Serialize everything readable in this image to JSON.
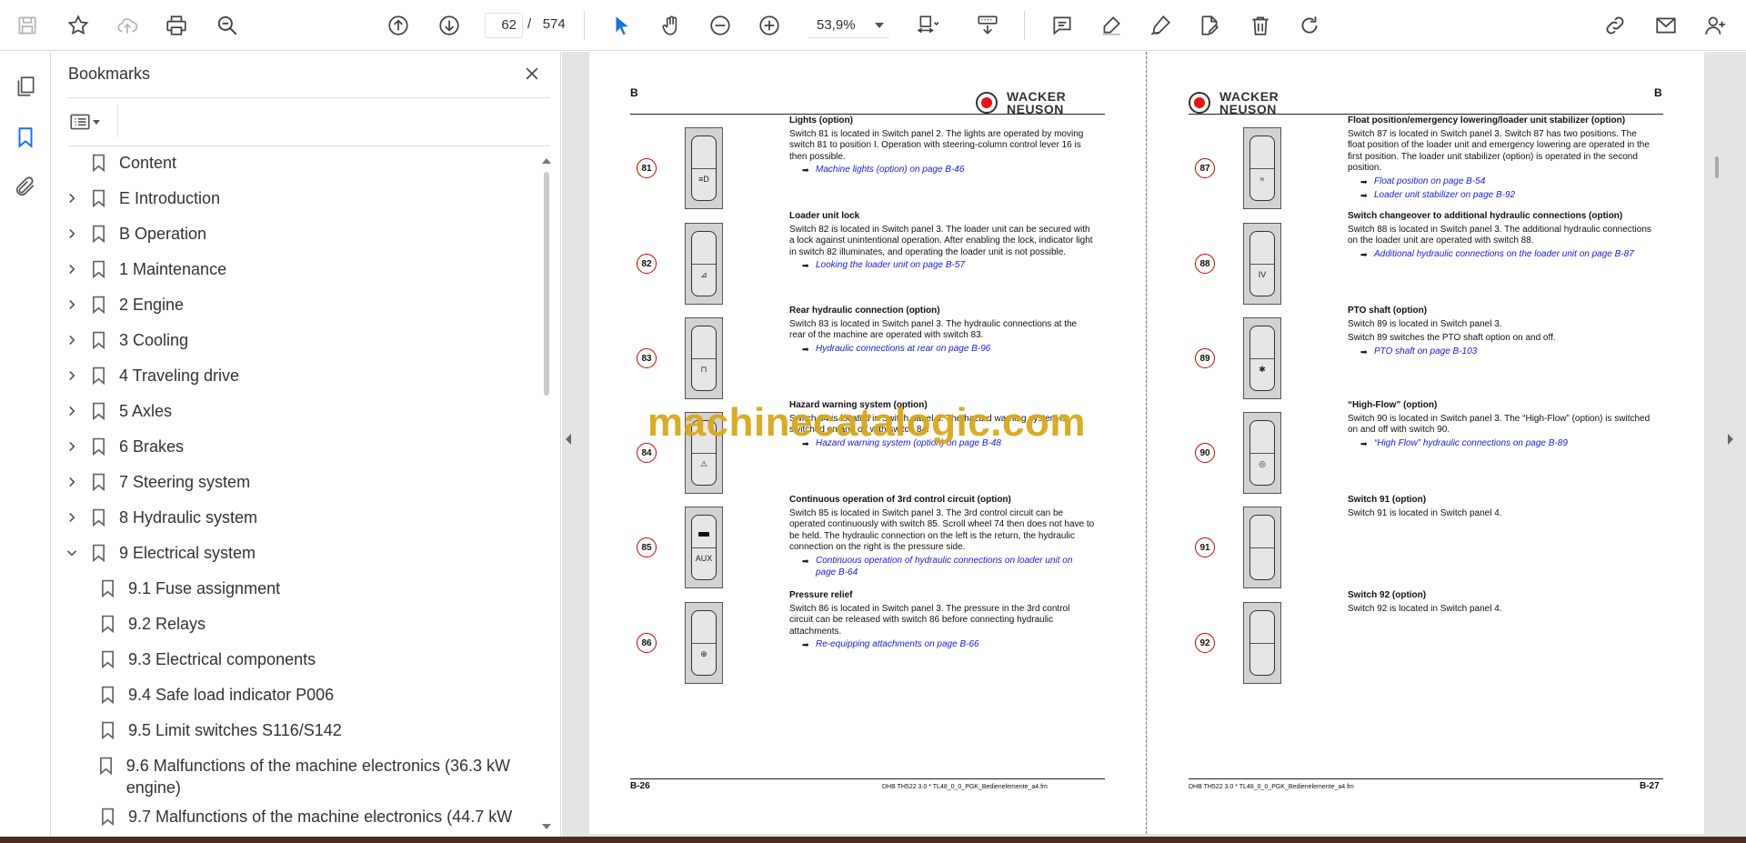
{
  "toolbar": {
    "page_current": "62",
    "page_total": "574",
    "page_sep": "/",
    "zoom": "53,9%"
  },
  "bookmarks_panel": {
    "title": "Bookmarks",
    "items": [
      {
        "label": "Content",
        "chevron": "none",
        "level": 0
      },
      {
        "label": "E Introduction",
        "chevron": "right",
        "level": 0
      },
      {
        "label": "B Operation",
        "chevron": "right",
        "level": 0
      },
      {
        "label": "1 Maintenance",
        "chevron": "right",
        "level": 0
      },
      {
        "label": "2 Engine",
        "chevron": "right",
        "level": 0
      },
      {
        "label": "3 Cooling",
        "chevron": "right",
        "level": 0
      },
      {
        "label": "4 Traveling drive",
        "chevron": "right",
        "level": 0
      },
      {
        "label": "5 Axles",
        "chevron": "right",
        "level": 0
      },
      {
        "label": "6 Brakes",
        "chevron": "right",
        "level": 0
      },
      {
        "label": "7 Steering system",
        "chevron": "right",
        "level": 0
      },
      {
        "label": "8 Hydraulic system",
        "chevron": "right",
        "level": 0
      },
      {
        "label": "9 Electrical system",
        "chevron": "down",
        "level": 0
      },
      {
        "label": "9.1 Fuse assignment",
        "chevron": "none",
        "level": 1
      },
      {
        "label": "9.2 Relays",
        "chevron": "none",
        "level": 1
      },
      {
        "label": "9.3 Electrical components",
        "chevron": "none",
        "level": 1
      },
      {
        "label": "9.4 Safe load indicator P006",
        "chevron": "none",
        "level": 1
      },
      {
        "label": "9.5 Limit switches S116/S142",
        "chevron": "none",
        "level": 1
      },
      {
        "label": "9.6 Malfunctions of the machine electronics (36.3 kW engine)",
        "chevron": "none",
        "level": 1
      },
      {
        "label": "9.7 Malfunctions of the machine electronics (44.7 kW",
        "chevron": "none",
        "level": 1
      }
    ]
  },
  "left_page": {
    "section_letter": "B",
    "logo_line1": "WACKER",
    "logo_line2": "NEUSON",
    "page_number": "B-26",
    "footer_file": "DHB TH522 3.0 * TL48_0_0_PGK_Bedienelemente_a4.fm",
    "entries": [
      {
        "num": "81",
        "symbol": "≡D",
        "title": "Lights (option)",
        "body": "Switch 81 is located in Switch panel 2. The lights are operated by moving switch 81 to position I. Operation with steering-column control lever 16 is then possible.",
        "refs": [
          "Machine lights (option) on page B-46"
        ]
      },
      {
        "num": "82",
        "symbol": "⊿",
        "title": "Loader unit lock",
        "body": "Switch 82 is located in Switch panel 3. The loader unit can be secured with a lock against unintentional operation. After enabling the lock, indicator light in switch 82 illuminates, and operating the loader unit is not possible.",
        "refs": [
          "Looking the loader unit on page B-57"
        ]
      },
      {
        "num": "83",
        "symbol": "⊓",
        "title": "Rear hydraulic connection (option)",
        "body": "Switch 83 is located in Switch panel 3. The hydraulic connections at the rear of the machine are operated with switch 83.",
        "refs": [
          "Hydraulic connections at rear on page B-96"
        ]
      },
      {
        "num": "84",
        "symbol": "⚠",
        "title": "Hazard warning system (option)",
        "body": "Switch 84 is located in Switch panel 3. The hazard warning system is switched on and off with switch 84.",
        "refs": [
          "Hazard warning system (option) on page B-48"
        ]
      },
      {
        "num": "85",
        "symbol": "AUX",
        "title": "Continuous operation of 3rd control circuit (option)",
        "body": "Switch 85 is located in Switch panel 3. The 3rd control circuit can be operated continuously with switch 85. Scroll wheel 74 then does not have to be held. The hydraulic connection on the left is the return, the hydraulic connection on the right is the pressure side.",
        "refs": [
          "Continuous operation of hydraulic connections on loader unit on page B-64"
        ]
      },
      {
        "num": "86",
        "symbol": "⊕",
        "title": "Pressure relief",
        "body": "Switch 86 is located in Switch panel 3. The pressure in the 3rd control circuit can be released with switch 86 before connecting hydraulic attachments.",
        "refs": [
          "Re-equipping attachments on page B-66"
        ]
      }
    ]
  },
  "right_page": {
    "section_letter": "B",
    "logo_line1": "WACKER",
    "logo_line2": "NEUSON",
    "page_number": "B-27",
    "footer_file": "DHB TH522 3.0 * TL48_0_0_PGK_Bedienelemente_a4.fm",
    "entries": [
      {
        "num": "87",
        "symbol": "≈",
        "title": "Float position/emergency lowering/loader unit stabilizer (option)",
        "body": "Switch 87 is located in Switch panel 3. Switch 87 has two positions. The float position of the loader unit and emergency lowering are operated in the first position. The loader unit stabilizer (option) is operated in the second position.",
        "refs": [
          "Float position on page B-54",
          "Loader unit stabilizer on page B-92"
        ]
      },
      {
        "num": "88",
        "symbol": "IV",
        "title": "Switch changeover to additional hydraulic connections (option)",
        "body": "Switch 88 is located in Switch panel 3. The additional hydraulic connections on the loader unit are operated with switch 88.",
        "refs": [
          "Additional hydraulic connections on the loader unit on page B-87"
        ]
      },
      {
        "num": "89",
        "symbol": "✱",
        "title": "PTO shaft (option)",
        "body": "Switch 89 is located in Switch panel 3.",
        "body2": "Switch 89 switches the PTO shaft option on and off.",
        "refs": [
          "PTO shaft on page B-103"
        ]
      },
      {
        "num": "90",
        "symbol": "◎",
        "title": "“High-Flow” (option)",
        "body": "Switch 90 is located in Switch panel 3. The “High-Flow” (option) is switched on and off with switch 90.",
        "refs": [
          "“High Flow” hydraulic connections on page B-89"
        ]
      },
      {
        "num": "91",
        "symbol": "",
        "title": "Switch 91 (option)",
        "body": "Switch 91 is located in Switch panel 4.",
        "refs": []
      },
      {
        "num": "92",
        "symbol": "",
        "title": "Switch 92 (option)",
        "body": "Switch 92 is located in Switch panel 4.",
        "refs": []
      }
    ]
  },
  "watermark": "machinecatalogic.com"
}
